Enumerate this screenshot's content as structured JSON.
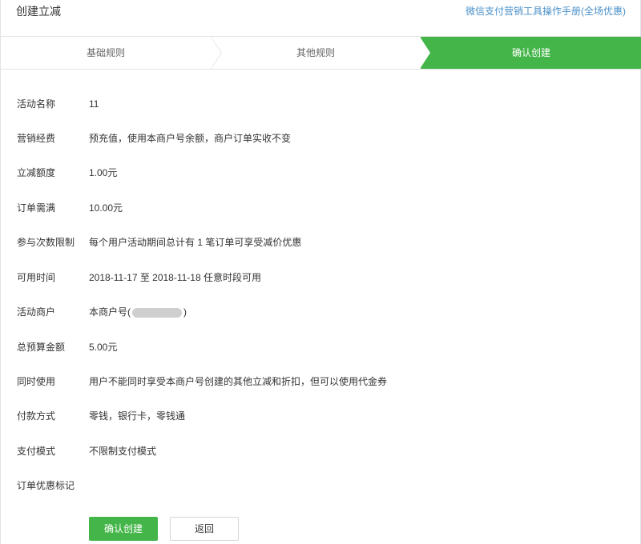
{
  "header": {
    "title": "创建立减",
    "manual_link": "微信支付营销工具操作手册(全场优惠)"
  },
  "steps": [
    {
      "label": "基础规则",
      "active": false
    },
    {
      "label": "其他规则",
      "active": false
    },
    {
      "label": "确认创建",
      "active": true
    }
  ],
  "accent_color": "#44b549",
  "details": [
    {
      "label": "活动名称",
      "value": "11"
    },
    {
      "label": "营销经费",
      "value": "预充值，使用本商户号余额，商户订单实收不变"
    },
    {
      "label": "立减额度",
      "value": "1.00元"
    },
    {
      "label": "订单需满",
      "value": "10.00元"
    },
    {
      "label": "参与次数限制",
      "value": "每个用户活动期间总计有 1 笔订单可享受减价优惠"
    },
    {
      "label": "可用时间",
      "value": "2018-11-17 至 2018-11-18 任意时段可用"
    },
    {
      "label": "活动商户",
      "value_prefix": "本商户号(",
      "value_suffix": ")"
    },
    {
      "label": "总预算金额",
      "value": "5.00元"
    },
    {
      "label": "同时使用",
      "value": "用户不能同时享受本商户号创建的其他立减和折扣，但可以使用代金券"
    },
    {
      "label": "付款方式",
      "value": "零钱，银行卡，零钱通"
    },
    {
      "label": "支付模式",
      "value": "不限制支付模式"
    },
    {
      "label": "订单优惠标记",
      "value": ""
    }
  ],
  "actions": {
    "confirm_label": "确认创建",
    "back_label": "返回"
  }
}
